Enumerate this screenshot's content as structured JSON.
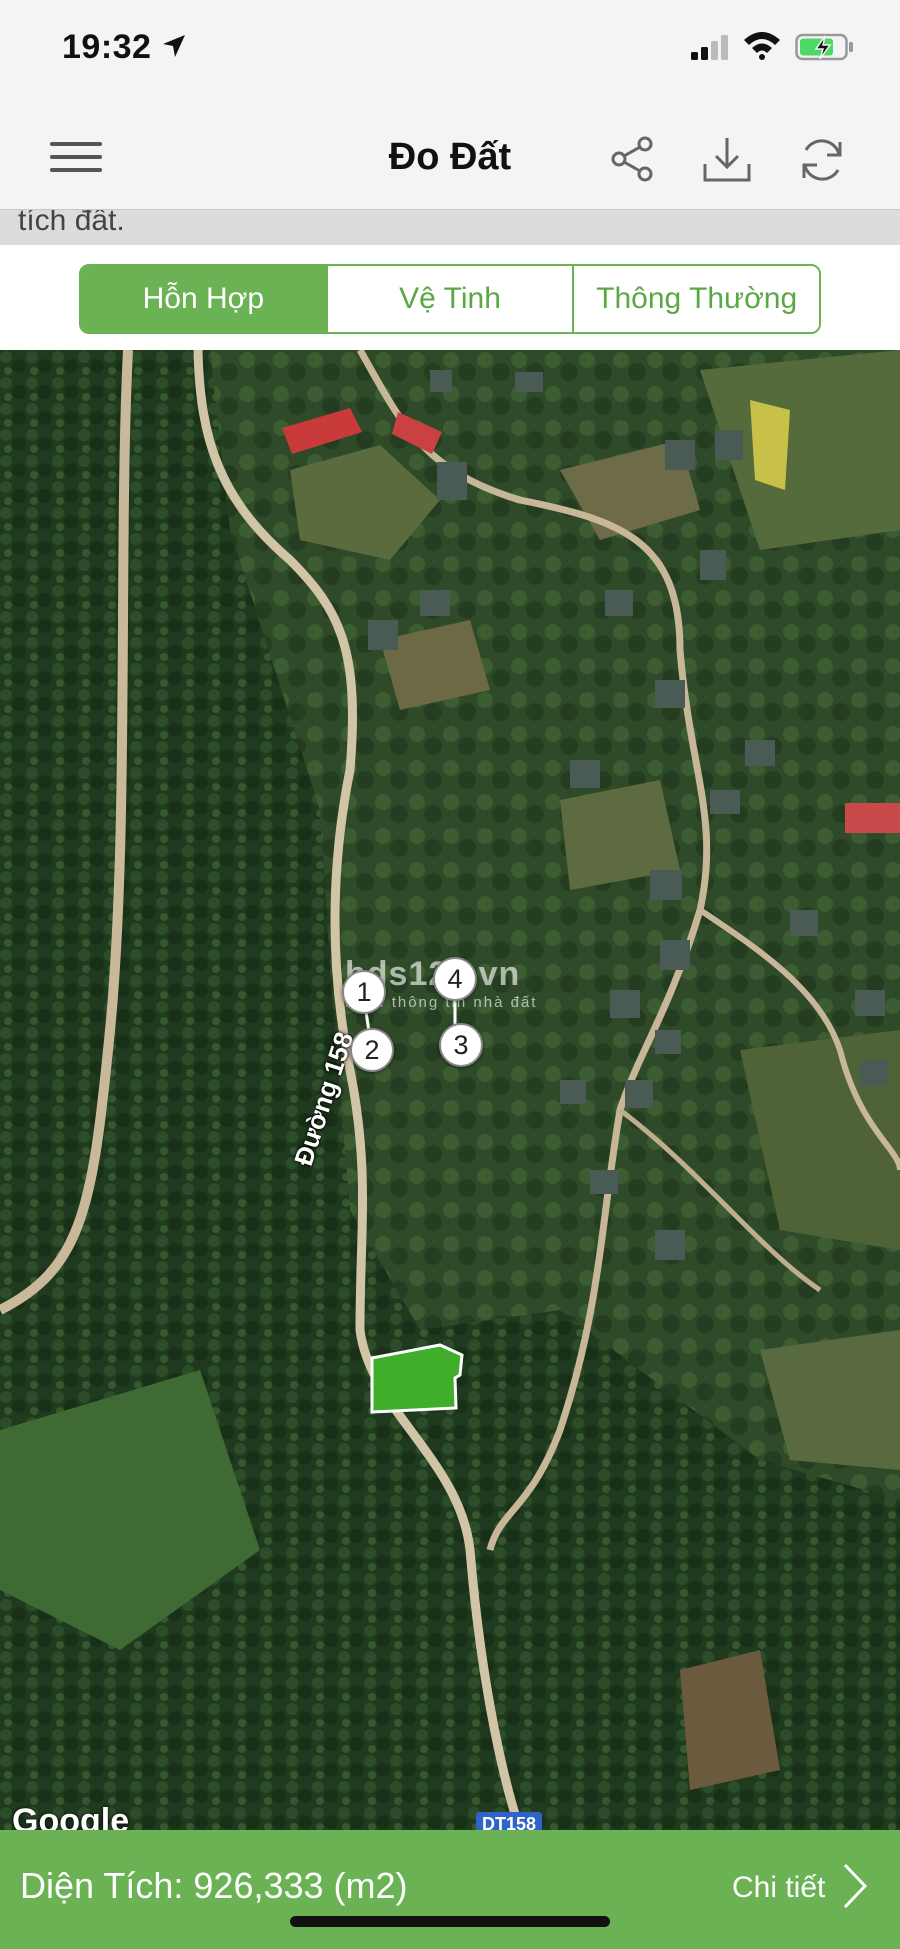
{
  "status_bar": {
    "time": "19:32",
    "icons": [
      "location-arrow-icon",
      "cellular-signal-icon",
      "wifi-icon",
      "battery-charging-icon"
    ]
  },
  "nav": {
    "title": "Đo Đất",
    "icons": [
      "menu-icon",
      "share-icon",
      "download-icon",
      "refresh-icon"
    ]
  },
  "clipped_text": "tích đất.",
  "map_types": {
    "tabs": [
      "Hỗn Hợp",
      "Vệ Tinh",
      "Thông Thường"
    ],
    "selected": "Hỗn Hợp"
  },
  "map": {
    "road_label": "Đường 158",
    "watermark": {
      "main": "bds123.vn",
      "sub": "kênh thông tin nhà đất"
    },
    "attribution": "Google",
    "route_shield": "DT158",
    "markers": [
      "1",
      "2",
      "3",
      "4"
    ]
  },
  "bottom": {
    "area_text": "Diện Tích: 926,333 (m2)",
    "detail_label": "Chi tiết"
  },
  "colors": {
    "accent": "#6ab254",
    "plot_fill": "#3fae2a"
  }
}
